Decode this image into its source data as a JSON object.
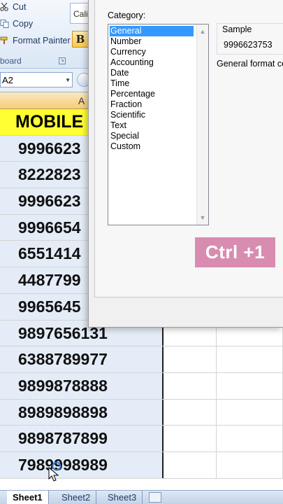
{
  "ribbon": {
    "cut_label": "Cut",
    "copy_label": "Copy",
    "format_painter_label": "Format Painter",
    "clipboard_label": "board",
    "font_name": "Cali",
    "bold_label": "B"
  },
  "formula_bar": {
    "name_box": "A2"
  },
  "grid": {
    "column_header": "A",
    "header_cell": "MOBILE",
    "rows": [
      "9996623",
      "8222823",
      "9996623",
      "9996654",
      "6551414",
      "4487799",
      "9965645",
      "9897656131",
      "6388789977",
      "9899878888",
      "8989898898",
      "9898787899",
      "7989998989"
    ]
  },
  "sheet_tabs": [
    "Sheet1",
    "Sheet2",
    "Sheet3"
  ],
  "dialog": {
    "category_label": "Category:",
    "categories": [
      "General",
      "Number",
      "Currency",
      "Accounting",
      "Date",
      "Time",
      "Percentage",
      "Fraction",
      "Scientific",
      "Text",
      "Special",
      "Custom"
    ],
    "selected_category": "General",
    "sample_label": "Sample",
    "sample_value": "9996623753",
    "general_description": "General format cell"
  },
  "shortcut_badge": "Ctrl +1",
  "colors": {
    "header_fill": "#ffff33",
    "selection_blue": "#3399ff",
    "badge_pink": "#d88db0"
  }
}
